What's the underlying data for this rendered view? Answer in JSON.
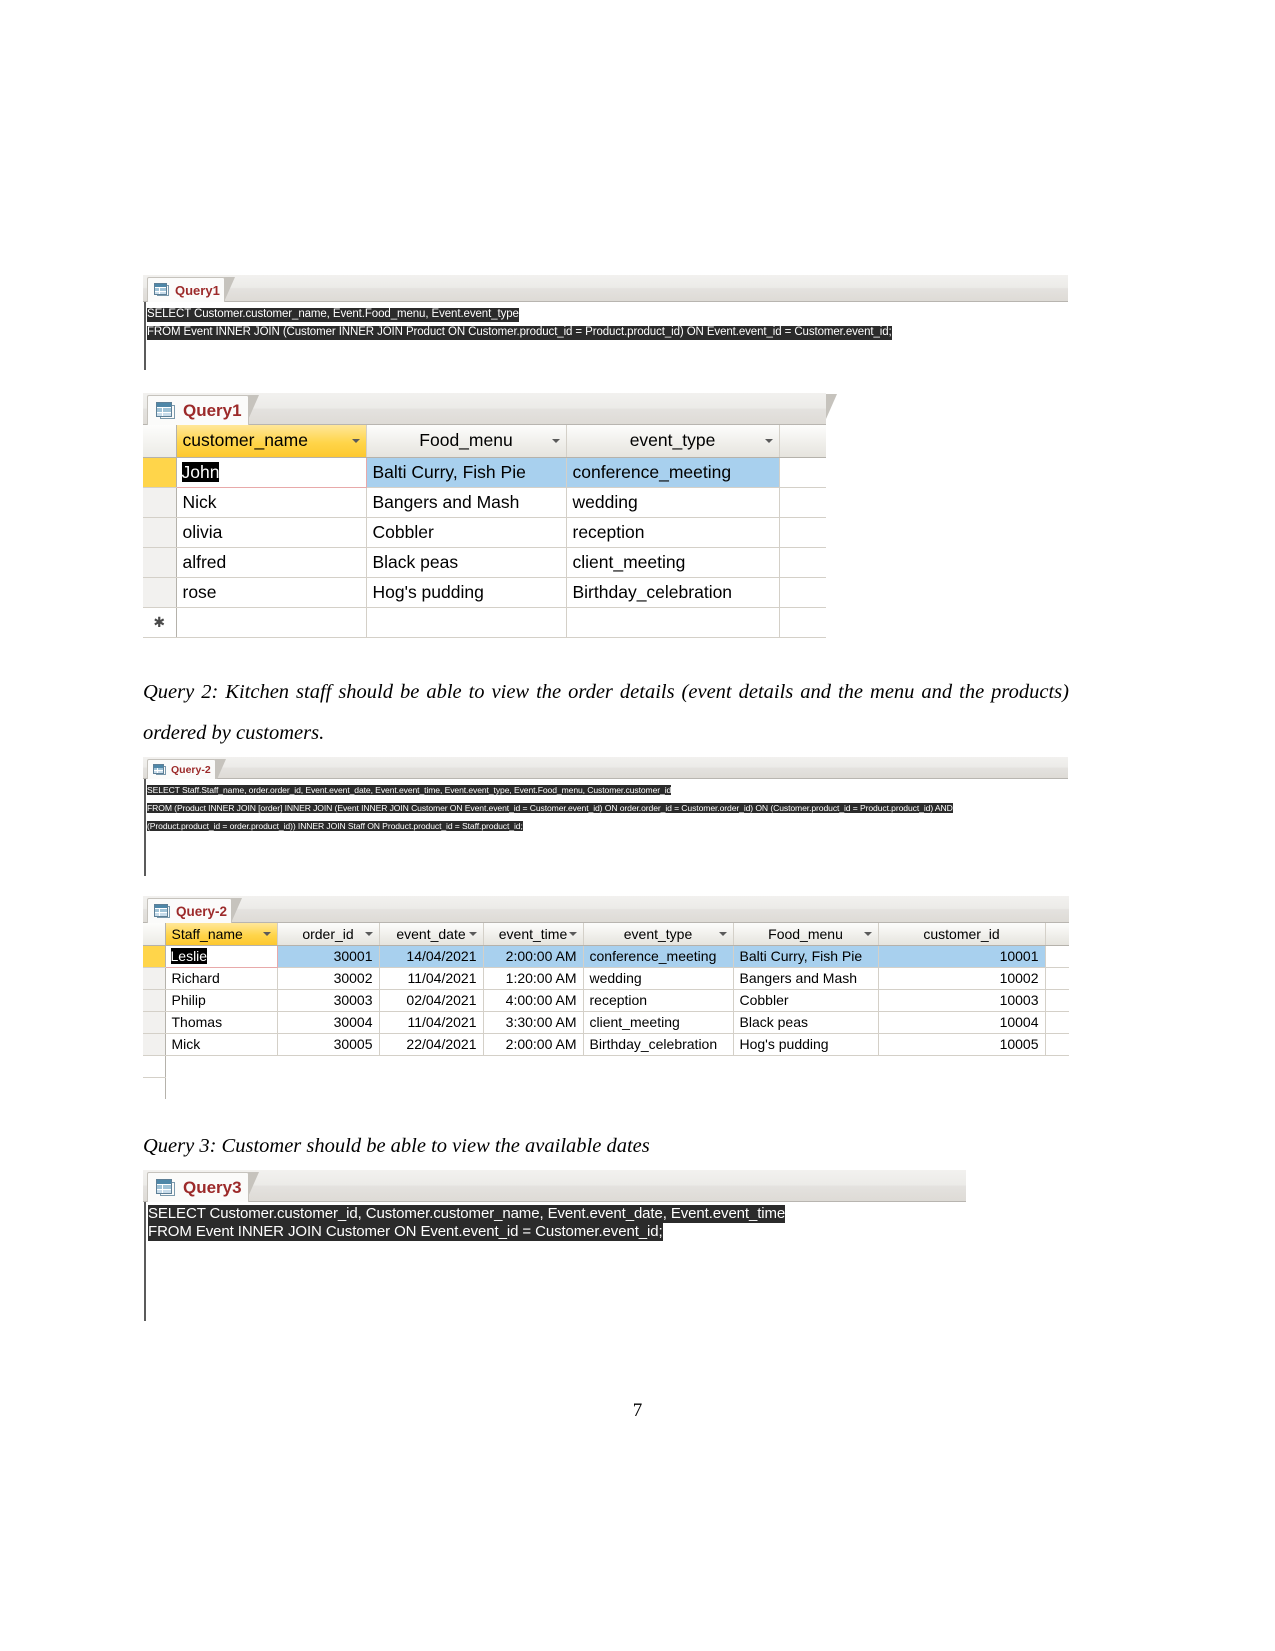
{
  "page": {
    "number": "7"
  },
  "query1": {
    "sql_tab_label": "Query1",
    "sql_lines": [
      "SELECT Customer.customer_name, Event.Food_menu, Event.event_type",
      "FROM Event INNER JOIN (Customer INNER JOIN Product ON Customer.product_id = Product.product_id) ON Event.event_id = Customer.event_id;"
    ],
    "ds_tab_label": "Query1",
    "columns": [
      "customer_name",
      "Food_menu",
      "event_type"
    ],
    "rows": [
      [
        "John",
        "Balti Curry, Fish Pie",
        "conference_meeting"
      ],
      [
        "Nick",
        "Bangers and Mash",
        "wedding"
      ],
      [
        "olivia",
        "Cobbler",
        "reception"
      ],
      [
        "alfred",
        "Black peas",
        "client_meeting"
      ],
      [
        "rose",
        "Hog's pudding",
        "Birthday_celebration"
      ]
    ],
    "new_record_marker": "✱"
  },
  "caption_query2": "Query 2: Kitchen staff should be able to view the order details (event details and the menu and the products) ordered by customers.",
  "query2": {
    "sql_tab_label": "Query-2",
    "sql_lines": [
      "SELECT Staff.Staff_name, order.order_id, Event.event_date, Event.event_time, Event.event_type, Event.Food_menu, Customer.customer_id",
      "FROM (Product INNER JOIN [order] INNER JOIN (Event INNER JOIN Customer ON Event.event_id = Customer.event_id) ON order.order_id = Customer.order_id) ON (Customer.product_id = Product.product_id) AND",
      "(Product.product_id = order.product_id)) INNER JOIN Staff ON Product.product_id = Staff.product_id;"
    ],
    "ds_tab_label": "Query-2",
    "columns": [
      "Staff_name",
      "order_id",
      "event_date",
      "event_time",
      "event_type",
      "Food_menu",
      "customer_id"
    ],
    "rows": [
      [
        "Leslie",
        "30001",
        "14/04/2021",
        "2:00:00 AM",
        "conference_meeting",
        "Balti Curry, Fish Pie",
        "10001"
      ],
      [
        "Richard",
        "30002",
        "11/04/2021",
        "1:20:00 AM",
        "wedding",
        "Bangers and Mash",
        "10002"
      ],
      [
        "Philip",
        "30003",
        "02/04/2021",
        "4:00:00 AM",
        "reception",
        "Cobbler",
        "10003"
      ],
      [
        "Thomas",
        "30004",
        "11/04/2021",
        "3:30:00 AM",
        "client_meeting",
        "Black peas",
        "10004"
      ],
      [
        "Mick",
        "30005",
        "22/04/2021",
        "2:00:00 AM",
        "Birthday_celebration",
        "Hog's pudding",
        "10005"
      ]
    ]
  },
  "caption_query3": "Query 3: Customer should be able to view the available dates",
  "query3": {
    "sql_tab_label": "Query3",
    "sql_lines": [
      "SELECT Customer.customer_id, Customer.customer_name, Event.event_date, Event.event_time",
      "FROM Event INNER JOIN Customer ON Event.event_id = Customer.event_id;"
    ]
  },
  "colors": {
    "sql_text_bg": "#2b2b2b",
    "tab_label": "#9c2a2a",
    "selected_header": "#ffd54a",
    "selected_row": "#a8d0ee"
  }
}
